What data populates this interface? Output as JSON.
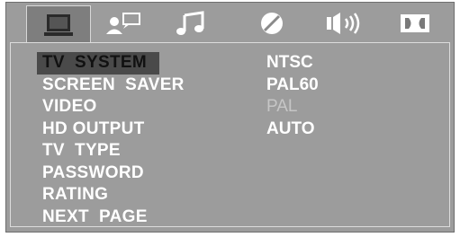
{
  "tabs": [
    {
      "icon": "monitor-icon",
      "active": true
    },
    {
      "icon": "person-speech-icon",
      "active": false
    },
    {
      "icon": "music-note-icon",
      "active": false
    },
    {
      "icon": "dial-icon",
      "active": false
    },
    {
      "icon": "speaker-icon",
      "active": false
    },
    {
      "icon": "dolby-icon",
      "active": false
    }
  ],
  "menu": {
    "items": [
      "TV  SYSTEM",
      "SCREEN  SAVER",
      "VIDEO",
      "HD OUTPUT",
      "TV  TYPE",
      "PASSWORD",
      "RATING",
      "NEXT  PAGE"
    ],
    "selected_index": 0
  },
  "options": {
    "items": [
      "NTSC",
      "PAL60",
      "PAL",
      "AUTO"
    ],
    "dimmed_index": 2
  },
  "colors": {
    "background": "#9c9c9c",
    "tab_active": "#7e7e7e",
    "highlight": "#4a4a4a",
    "text": "#ffffff",
    "text_dim": "#c6c6c6"
  }
}
